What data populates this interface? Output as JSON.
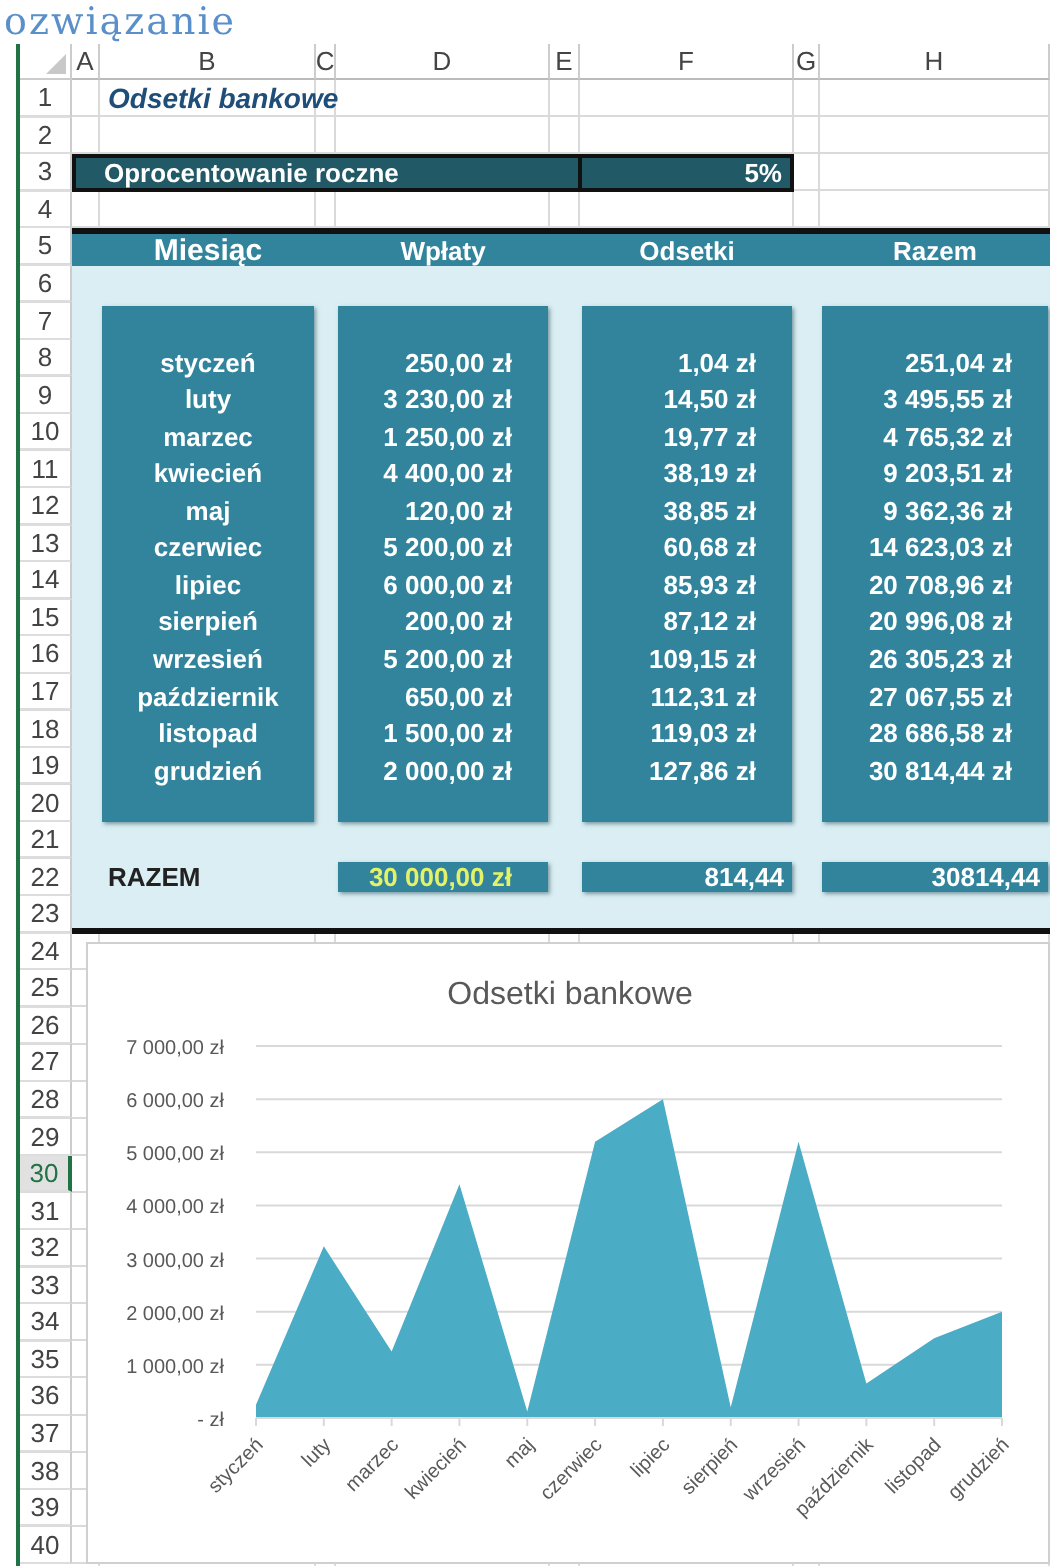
{
  "document_heading": "ozwiązanie",
  "sheet": {
    "column_headers": [
      "A",
      "B",
      "C",
      "D",
      "E",
      "F",
      "G",
      "H"
    ],
    "row_headers": [
      {
        "label": "1",
        "selected": false
      },
      {
        "label": "2",
        "selected": false
      },
      {
        "label": "3",
        "selected": false
      },
      {
        "label": "4",
        "selected": false
      },
      {
        "label": "5",
        "selected": false
      },
      {
        "label": "6",
        "selected": false
      },
      {
        "label": "7",
        "selected": false
      },
      {
        "label": "8",
        "selected": false
      },
      {
        "label": "9",
        "selected": false
      },
      {
        "label": "10",
        "selected": false
      },
      {
        "label": "11",
        "selected": false
      },
      {
        "label": "12",
        "selected": false
      },
      {
        "label": "13",
        "selected": false
      },
      {
        "label": "14",
        "selected": false
      },
      {
        "label": "15",
        "selected": false
      },
      {
        "label": "16",
        "selected": false
      },
      {
        "label": "17",
        "selected": false
      },
      {
        "label": "18",
        "selected": false
      },
      {
        "label": "19",
        "selected": false
      },
      {
        "label": "20",
        "selected": false
      },
      {
        "label": "21",
        "selected": false
      },
      {
        "label": "22",
        "selected": false
      },
      {
        "label": "23",
        "selected": false
      },
      {
        "label": "24",
        "selected": false
      },
      {
        "label": "25",
        "selected": false
      },
      {
        "label": "26",
        "selected": false
      },
      {
        "label": "27",
        "selected": false
      },
      {
        "label": "28",
        "selected": false
      },
      {
        "label": "29",
        "selected": false
      },
      {
        "label": "30",
        "selected": true
      },
      {
        "label": "31",
        "selected": false
      },
      {
        "label": "32",
        "selected": false
      },
      {
        "label": "33",
        "selected": false
      },
      {
        "label": "34",
        "selected": false
      },
      {
        "label": "35",
        "selected": false
      },
      {
        "label": "36",
        "selected": false
      },
      {
        "label": "37",
        "selected": false
      },
      {
        "label": "38",
        "selected": false
      },
      {
        "label": "39",
        "selected": false
      },
      {
        "label": "40",
        "selected": false
      }
    ],
    "title": "Odsetki bankowe",
    "rate": {
      "label": "Oprocentowanie roczne",
      "value": "5%"
    },
    "table": {
      "columns": [
        "Miesiąc",
        "Wpłaty",
        "Odsetki",
        "Razem"
      ],
      "rows": [
        {
          "month": "styczeń",
          "deposit": "250,00 zł",
          "interest": "1,04 zł",
          "total": "251,04 zł"
        },
        {
          "month": "luty",
          "deposit": "3 230,00 zł",
          "interest": "14,50 zł",
          "total": "3 495,55 zł"
        },
        {
          "month": "marzec",
          "deposit": "1 250,00 zł",
          "interest": "19,77 zł",
          "total": "4 765,32 zł"
        },
        {
          "month": "kwiecień",
          "deposit": "4 400,00 zł",
          "interest": "38,19 zł",
          "total": "9 203,51 zł"
        },
        {
          "month": "maj",
          "deposit": "120,00 zł",
          "interest": "38,85 zł",
          "total": "9 362,36 zł"
        },
        {
          "month": "czerwiec",
          "deposit": "5 200,00 zł",
          "interest": "60,68 zł",
          "total": "14 623,03 zł"
        },
        {
          "month": "lipiec",
          "deposit": "6 000,00 zł",
          "interest": "85,93 zł",
          "total": "20 708,96 zł"
        },
        {
          "month": "sierpień",
          "deposit": "200,00 zł",
          "interest": "87,12 zł",
          "total": "20 996,08 zł"
        },
        {
          "month": "wrzesień",
          "deposit": "5 200,00 zł",
          "interest": "109,15 zł",
          "total": "26 305,23 zł"
        },
        {
          "month": "październik",
          "deposit": "650,00 zł",
          "interest": "112,31 zł",
          "total": "27 067,55 zł"
        },
        {
          "month": "listopad",
          "deposit": "1 500,00 zł",
          "interest": "119,03 zł",
          "total": "28 686,58 zł"
        },
        {
          "month": "grudzień",
          "deposit": "2 000,00 zł",
          "interest": "127,86 zł",
          "total": "30 814,44 zł"
        }
      ],
      "totals": {
        "label": "RAZEM",
        "deposit": "30 000,00 zł",
        "interest": "814,44",
        "total": "30814,44"
      }
    },
    "chart": {
      "chart_data": {
        "type": "area",
        "title": "Odsetki bankowe",
        "categories": [
          "styczeń",
          "luty",
          "marzec",
          "kwiecień",
          "maj",
          "czerwiec",
          "lipiec",
          "sierpień",
          "wrzesień",
          "październik",
          "listopad",
          "grudzień"
        ],
        "grid": true,
        "series": [
          {
            "color": "#4bacc6",
            "values": [
              250,
              3230,
              1250,
              4400,
              120,
              5200,
              6000,
              200,
              5200,
              650,
              1500,
              2000
            ]
          }
        ],
        "ylim": [
          0,
          7000
        ],
        "yticks": [
          {
            "value": 0,
            "label": "-   zł"
          },
          {
            "value": 1000,
            "label": "1 000,00 zł"
          },
          {
            "value": 2000,
            "label": "2 000,00 zł"
          },
          {
            "value": 3000,
            "label": "3 000,00 zł"
          },
          {
            "value": 4000,
            "label": "4 000,00 zł"
          },
          {
            "value": 5000,
            "label": "5 000,00 zł"
          },
          {
            "value": 6000,
            "label": "6 000,00 zł"
          },
          {
            "value": 7000,
            "label": "7 000,00 zł"
          }
        ]
      }
    }
  }
}
